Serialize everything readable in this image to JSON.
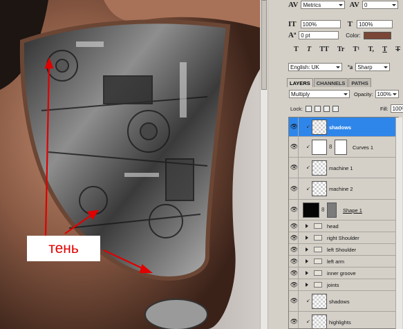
{
  "annotation": {
    "label": "тень",
    "color": "#e00000"
  },
  "character_panel": {
    "kerning_value": "Metrics",
    "tracking_value": "0",
    "vertical_scale": "100%",
    "horizontal_scale": "100%",
    "baseline_shift": "0 pt",
    "color_label": "Color:",
    "text_color": "#7a4636",
    "language": "English: UK",
    "aa_glyph": "ªa",
    "antialias": "Sharp",
    "style_buttons": [
      "T",
      "T",
      "TT",
      "Tr",
      "T¹",
      "T,",
      "T",
      "T"
    ]
  },
  "layers_panel": {
    "tabs": [
      "LAYERS",
      "CHANNELS",
      "PATHS"
    ],
    "blend_mode": "Multiply",
    "opacity_label": "Opacity:",
    "opacity_value": "100%",
    "lock_label": "Lock:",
    "fill_label": "Fill:",
    "fill_value": "100%",
    "selected_color": "#2f86ea",
    "layers": [
      {
        "name": "shadows",
        "kind": "layer",
        "selected": true
      },
      {
        "name": "Curves 1",
        "kind": "adjustment"
      },
      {
        "name": "machine 1",
        "kind": "layer"
      },
      {
        "name": "machine 2",
        "kind": "layer"
      },
      {
        "name": "Shape 1",
        "kind": "shape"
      },
      {
        "name": "head",
        "kind": "group"
      },
      {
        "name": "right Shoulder",
        "kind": "group"
      },
      {
        "name": "left Shoulder",
        "kind": "group"
      },
      {
        "name": "left arm",
        "kind": "group"
      },
      {
        "name": "inner groove",
        "kind": "group"
      },
      {
        "name": "joints",
        "kind": "group"
      },
      {
        "name": "shadows",
        "kind": "layer"
      },
      {
        "name": "highlights",
        "kind": "layer"
      }
    ]
  }
}
